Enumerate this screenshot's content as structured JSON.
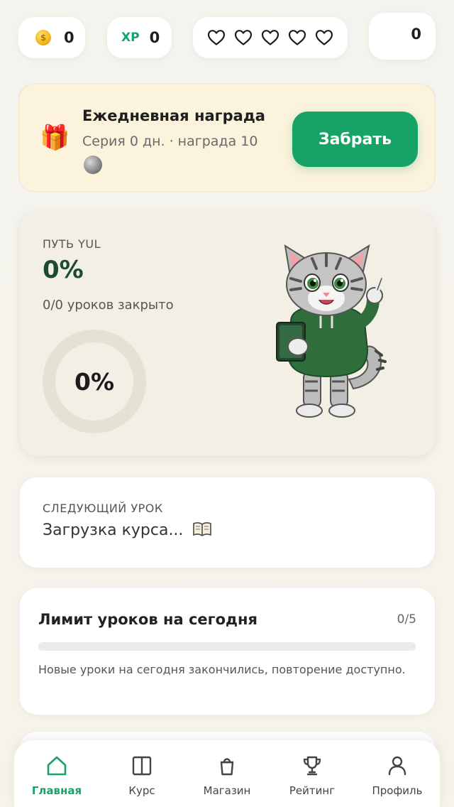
{
  "status": {
    "coins": "0",
    "xp_label": "XP",
    "xp": "0",
    "hearts_total": 5,
    "extra_value": "0"
  },
  "reward": {
    "title": "Ежедневная награда",
    "subtitle": "Серия 0 дн. · награда 10",
    "button": "Забрать"
  },
  "path": {
    "label": "ПУТЬ YUL",
    "percent": "0%",
    "lessons": "0/0 уроков закрыто",
    "ring_percent": "0%"
  },
  "next_lesson": {
    "label": "СЛЕДУЮЩИЙ УРОК",
    "text": "Загрузка курса..."
  },
  "limit": {
    "title": "Лимит уроков на сегодня",
    "count": "0/5",
    "progress": 0,
    "note": "Новые уроки на сегодня закончились, повторение доступно."
  },
  "nav": {
    "home": "Главная",
    "course": "Курс",
    "shop": "Магазин",
    "rating": "Рейтинг",
    "profile": "Профиль"
  },
  "colors": {
    "accent": "#17a266",
    "path_percent": "#1c4a34",
    "reward_bg": "#fbf3dc"
  }
}
